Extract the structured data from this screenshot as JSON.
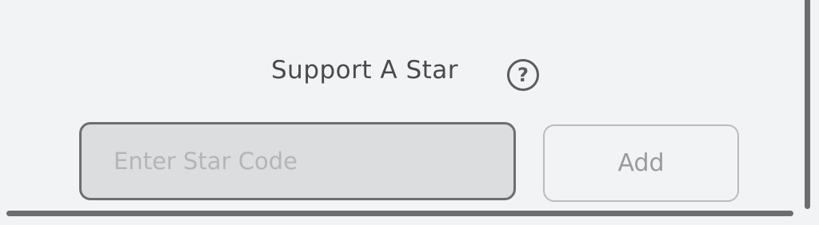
{
  "support": {
    "title": "Support A Star",
    "help_icon_glyph": "?",
    "help_icon": "question-circle-icon"
  },
  "star_code": {
    "value": "",
    "placeholder": "Enter Star Code"
  },
  "add_button": {
    "label": "Add"
  },
  "colors": {
    "background": "#f2f3f5",
    "input_background": "#dcddde",
    "input_border": "#6e6e6e",
    "button_border": "#bcbcbe",
    "button_text": "#9a9b9d",
    "text": "#4a4a4a",
    "divider": "#6d6d6d"
  }
}
